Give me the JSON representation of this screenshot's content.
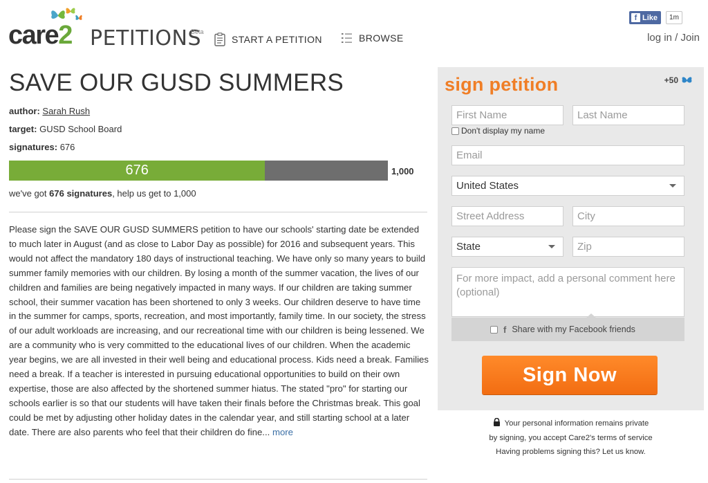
{
  "header": {
    "logo_care": "care",
    "logo_two": "2",
    "logo_petitions": "PETITIONS",
    "logo_beta": "Beta",
    "nav": {
      "start_label": "START A PETITION",
      "browse_label": "BROWSE"
    },
    "fb": {
      "like_label": "Like",
      "count": "1m"
    },
    "auth": {
      "login": "log in",
      "sep": "/",
      "join": "Join"
    }
  },
  "petition": {
    "title": "SAVE OUR GUSD SUMMERS",
    "author_label": "author:",
    "author_name": "Sarah Rush",
    "target_label": "target:",
    "target_value": "GUSD School Board",
    "signatures_label": "signatures:",
    "signatures_value": "676",
    "progress": {
      "current": 676,
      "goal": 1000,
      "current_text": "676",
      "goal_text": "1,000"
    },
    "got_prefix": "we've got ",
    "got_bold": "676 signatures",
    "got_suffix": ", help us get to 1,000",
    "body": "Please sign the SAVE OUR GUSD SUMMERS petition to have our schools' starting date be extended to much later in August (and as close to Labor Day as possible) for 2016 and subsequent years. This would not affect the mandatory 180 days of instructional teaching. We have only so many years to build summer family memories with our children. By losing a month of the summer vacation, the lives of our children and families are being negatively impacted in many ways. If our children are taking summer school, their summer vacation has been shortened to only 3 weeks. Our children deserve to have time in the summer for camps, sports, recreation, and most importantly, family time. In our society, the stress of our adult workloads are increasing, and our recreational time with our children is being lessened. We are a community who is very committed to the educational lives of our children. When the academic year begins, we are all invested in their well being and educational process. Kids need a break. Families need a break. If a teacher is interested in pursuing educational opportunities to build on their own expertise, those are also affected by the shortened summer hiatus. The stated \"pro\" for starting our schools earlier is so that our students will have taken their finals before the Christmas break. This goal could be met by adjusting other holiday dates in the calendar year, and still starting school at a later date. There are also parents who feel that their children do fine...",
    "more_label": "more"
  },
  "sign": {
    "title": "sign petition",
    "badge": "+50",
    "first_name_placeholder": "First Name",
    "last_name_placeholder": "Last Name",
    "dont_display_label": "Don't display my name",
    "email_placeholder": "Email",
    "country_value": "United States",
    "street_placeholder": "Street Address",
    "city_placeholder": "City",
    "state_value": "State",
    "zip_placeholder": "Zip",
    "comment_placeholder": "For more impact, add a personal comment here (optional)",
    "share_icon_letter": "f",
    "share_label": "Share with my Facebook friends",
    "button_label": "Sign Now"
  },
  "privacy": {
    "line1": "Your personal information remains private",
    "line2": "by signing, you accept Care2's terms of service",
    "line3": "Having problems signing this? Let us know."
  },
  "colors": {
    "accent_orange": "#f07e26",
    "progress_green": "#78ac38",
    "progress_gray": "#6e6e6e",
    "facebook_blue": "#4e69a2",
    "link_blue": "#3a6ea5"
  }
}
